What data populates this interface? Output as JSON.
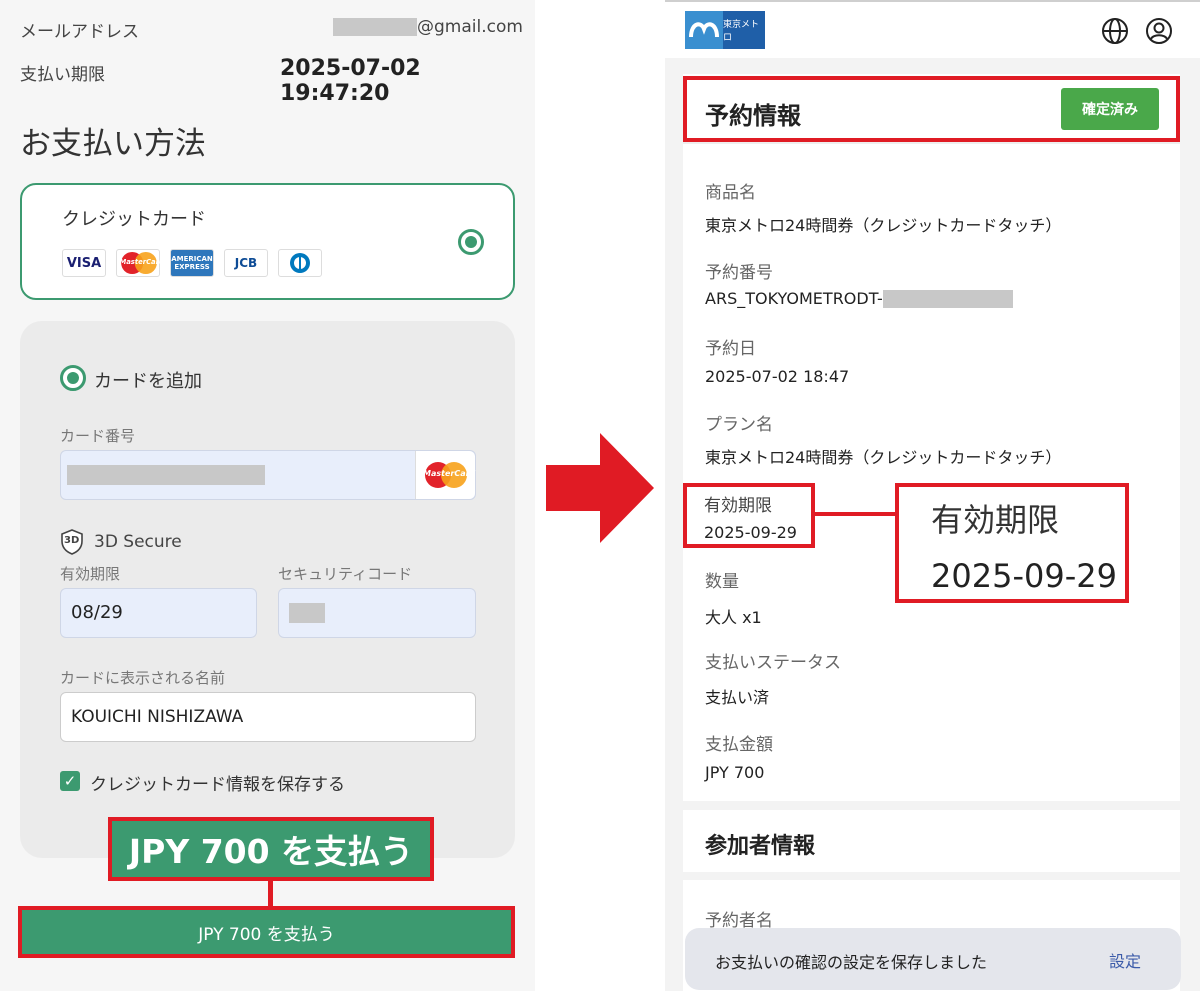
{
  "left": {
    "email_label": "メールアドレス",
    "email_value": "@gmail.com",
    "deadline_label": "支払い期限",
    "deadline_value": "2025-07-02 19:47:20",
    "method_title": "お支払い方法",
    "credit_label": "クレジットカード",
    "brands": [
      "VISA",
      "MasterCard",
      "AMERICAN EXPRESS",
      "JCB",
      "Diners"
    ],
    "add_card_label": "カードを追加",
    "card_number_label": "カード番号",
    "secure_label": "3D Secure",
    "secure_badge": "3D",
    "expiry_label": "有効期限",
    "expiry_value": "08/29",
    "security_code_label": "セキュリティコード",
    "name_label": "カードに表示される名前",
    "name_value": "KOUICHI NISHIZAWA",
    "save_card_label": "クレジットカード情報を保存する",
    "pay_callout": "JPY 700 を支払う",
    "pay_button": "JPY 700 を支払う"
  },
  "right": {
    "logo_text": "東京メトロ",
    "reservation_title": "予約情報",
    "confirmed_badge": "確定済み",
    "fields": [
      {
        "label": "商品名",
        "value": "東京メトロ24時間券（クレジットカードタッチ）"
      },
      {
        "label": "予約番号",
        "value": "ARS_TOKYOMETRODT-"
      },
      {
        "label": "予約日",
        "value": "2025-07-02 18:47"
      },
      {
        "label": "プラン名",
        "value": "東京メトロ24時間券（クレジットカードタッチ）"
      },
      {
        "label": "有効期限",
        "value": "2025-09-29"
      },
      {
        "label": "数量",
        "value": "大人 x1"
      },
      {
        "label": "支払いステータス",
        "value": "支払い済"
      },
      {
        "label": "支払金額",
        "value": "JPY 700"
      }
    ],
    "callout_label": "有効期限",
    "callout_value": "2025-09-29",
    "participant_title": "参加者情報",
    "booker_label": "予約者名",
    "snackbar_text": "お支払いの確認の設定を保存しました",
    "snackbar_action": "設定"
  },
  "colors": {
    "accent_green": "#3c9a70",
    "confirmed_green": "#4aa84a",
    "highlight_red": "#e01b24"
  }
}
